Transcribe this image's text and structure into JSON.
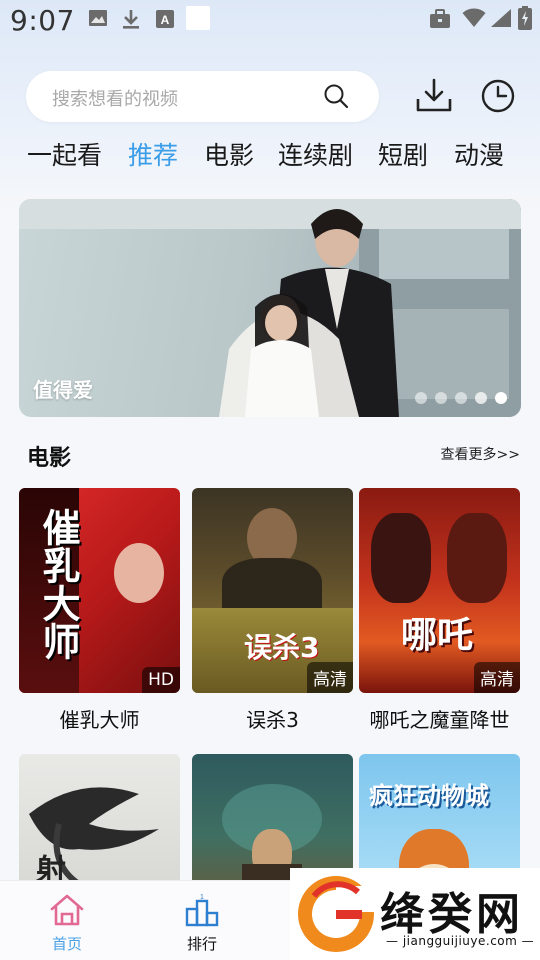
{
  "status_bar": {
    "time": "9:07"
  },
  "search": {
    "placeholder": "搜索想看的视频"
  },
  "tabs": [
    {
      "label": "一起看"
    },
    {
      "label": "推荐"
    },
    {
      "label": "电影"
    },
    {
      "label": "连续剧"
    },
    {
      "label": "短剧"
    },
    {
      "label": "动漫"
    }
  ],
  "active_tab": "推荐",
  "banner": {
    "caption": "值得爱",
    "slide_count": 5,
    "active_slide": 5
  },
  "section": {
    "title": "电影",
    "more": "查看更多>>"
  },
  "movies": [
    {
      "title": "催乳大师",
      "badge": "HD",
      "poster_text": "催乳大师"
    },
    {
      "title": "误杀3",
      "badge": "高清",
      "poster_text": "误杀3"
    },
    {
      "title": "哪吒之魔童降世",
      "badge": "高清",
      "poster_text": "哪吒"
    },
    {
      "title": "",
      "badge": "",
      "poster_text": "射雕"
    },
    {
      "title": "",
      "badge": "",
      "poster_text": ""
    },
    {
      "title": "",
      "badge": "",
      "poster_text": "疯狂动物城"
    }
  ],
  "bottom_nav": [
    {
      "label": "首页",
      "active": true
    },
    {
      "label": "排行",
      "active": false
    }
  ],
  "watermark": {
    "text": "绛癸网",
    "url": "— jiangguijiuye.com —"
  },
  "colors": {
    "accent": "#3a9de8",
    "nav_active": "#e26a92",
    "watermark_orange": "#f08a1c"
  }
}
